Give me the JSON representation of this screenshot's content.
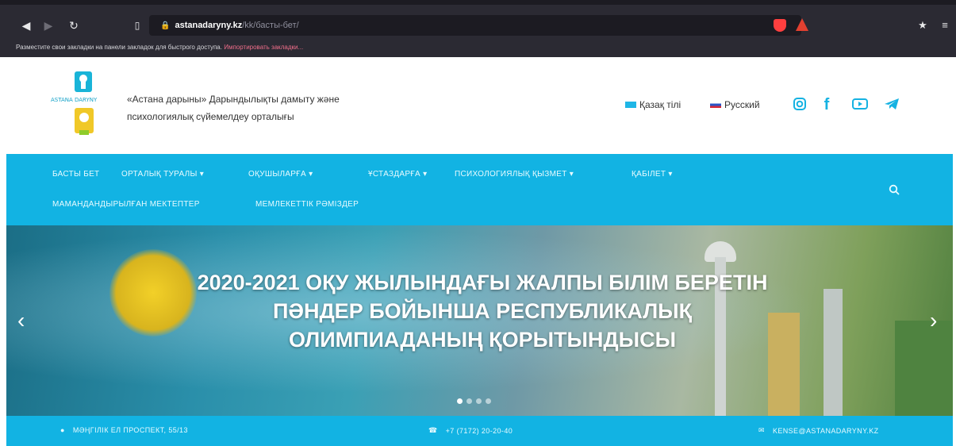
{
  "browser": {
    "url_host": "astanadaryny.kz",
    "url_path": "/kk/басты-бет/",
    "bookmarks_text": "Разместите свои закладки на панели закладок для быстрого доступа.",
    "bookmarks_link": "Импортировать закладки..."
  },
  "header": {
    "org_line1": "«Астана дарыны» Дарындылықты дамыту және",
    "org_line2": "психологиялық сүйемелдеу орталығы",
    "logo_text": "ASTANA DARYNY",
    "lang_kz": "Қазақ тілі",
    "lang_ru": "Русский"
  },
  "nav": {
    "items": [
      "БАСТЫ БЕТ",
      "ОРТАЛЫҚ ТУРАЛЫ",
      "ОҚУШЫЛАРҒА",
      "ҰСТАЗДАРҒА",
      "ПСИХОЛОГИЯЛЫҚ ҚЫЗМЕТ",
      "ҚАБІЛЕТ",
      "МАМАНДАНДЫРЫЛҒАН МЕКТЕПТЕР",
      "МЕМЛЕКЕТТІК РӘМІЗДЕР"
    ]
  },
  "hero": {
    "title_line1": "2020-2021 ОҚУ ЖЫЛЫНДАҒЫ ЖАЛПЫ БІЛІМ БЕРЕТІН",
    "title_line2": "ПӘНДЕР БОЙЫНША РЕСПУБЛИКАЛЫҚ",
    "title_line3": "ОЛИМПИАДАНЫҢ ҚОРЫТЫНДЫСЫ",
    "slide_count": 4,
    "active_slide": 1
  },
  "contact": {
    "address": "МӘҢГІЛІК ЕЛ ПРОСПЕКТ, 55/13",
    "phone": "+7 (7172) 20-20-40",
    "email": "KENSE@ASTANADARYNY.KZ"
  },
  "colors": {
    "nav_blue": "#12b3e3",
    "icon_blue": "#15b2e2",
    "chrome_dark": "#2b2a33"
  }
}
